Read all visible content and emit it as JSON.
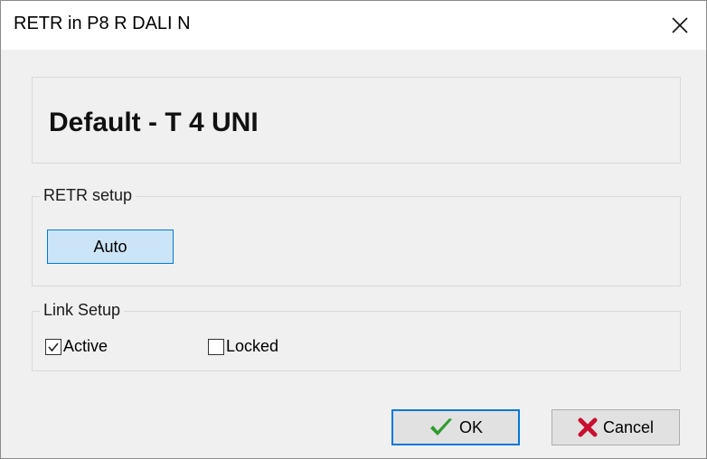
{
  "window": {
    "title": "RETR in P8 R DALI N"
  },
  "header": {
    "text": "Default - T 4 UNI"
  },
  "retr_setup": {
    "legend": "RETR setup",
    "auto_label": "Auto"
  },
  "link_setup": {
    "legend": "Link Setup",
    "active_label": "Active",
    "active_checked": true,
    "locked_label": "Locked",
    "locked_checked": false
  },
  "buttons": {
    "ok_label": "OK",
    "cancel_label": "Cancel"
  },
  "icons": {
    "close": "close-icon",
    "ok": "checkmark-icon",
    "cancel": "cross-icon"
  },
  "colors": {
    "ok_icon": "#2e9b2e",
    "cancel_icon": "#c8102e",
    "focus": "#0078d7"
  }
}
